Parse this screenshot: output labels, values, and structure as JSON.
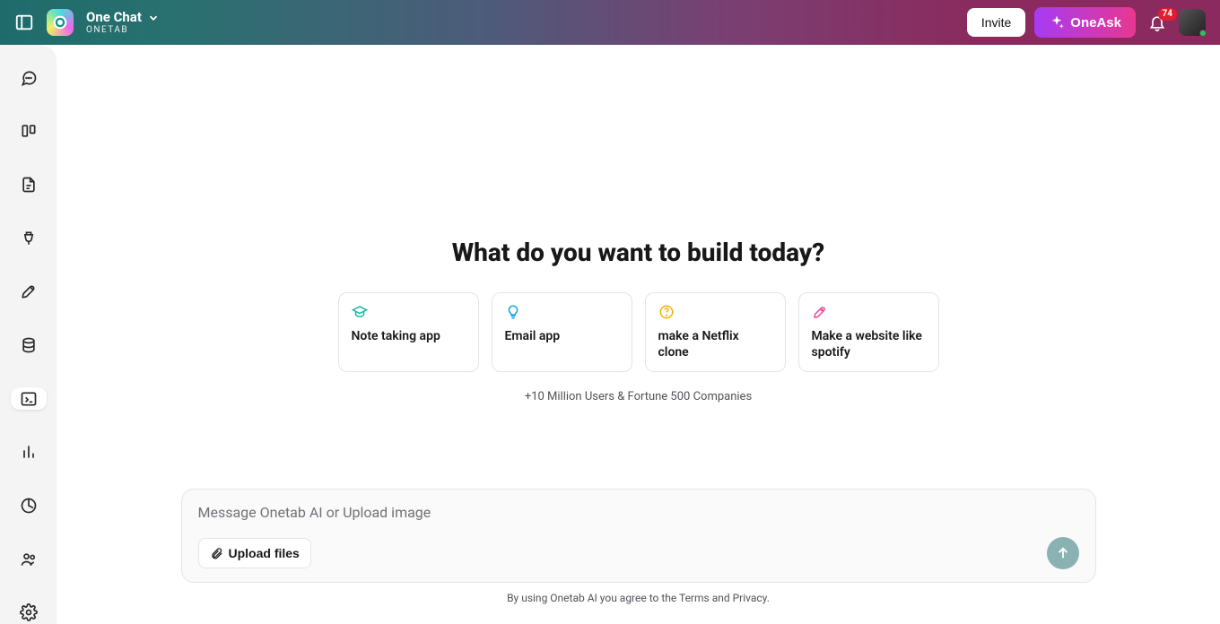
{
  "header": {
    "app_title": "One Chat",
    "app_subtitle": "ONETAB",
    "invite_label": "Invite",
    "oneask_label": "OneAsk",
    "notification_count": "74"
  },
  "main": {
    "hero_title": "What do you want to build today?",
    "cards": [
      {
        "label": "Note taking app",
        "icon_color": "#14b8a6"
      },
      {
        "label": "Email app",
        "icon_color": "#0ea5e9"
      },
      {
        "label": "make a Netflix clone",
        "icon_color": "#eab308"
      },
      {
        "label": "Make a website like spotify",
        "icon_color": "#ec4899"
      }
    ],
    "trust_line": "+10 Million Users & Fortune 500 Companies"
  },
  "input": {
    "placeholder": "Message Onetab AI or Upload image",
    "upload_label": "Upload files"
  },
  "footer": {
    "prefix": "By using Onetab AI you agree to the ",
    "terms": "Terms",
    "and": " and ",
    "privacy": "Privacy",
    "suffix": "."
  }
}
